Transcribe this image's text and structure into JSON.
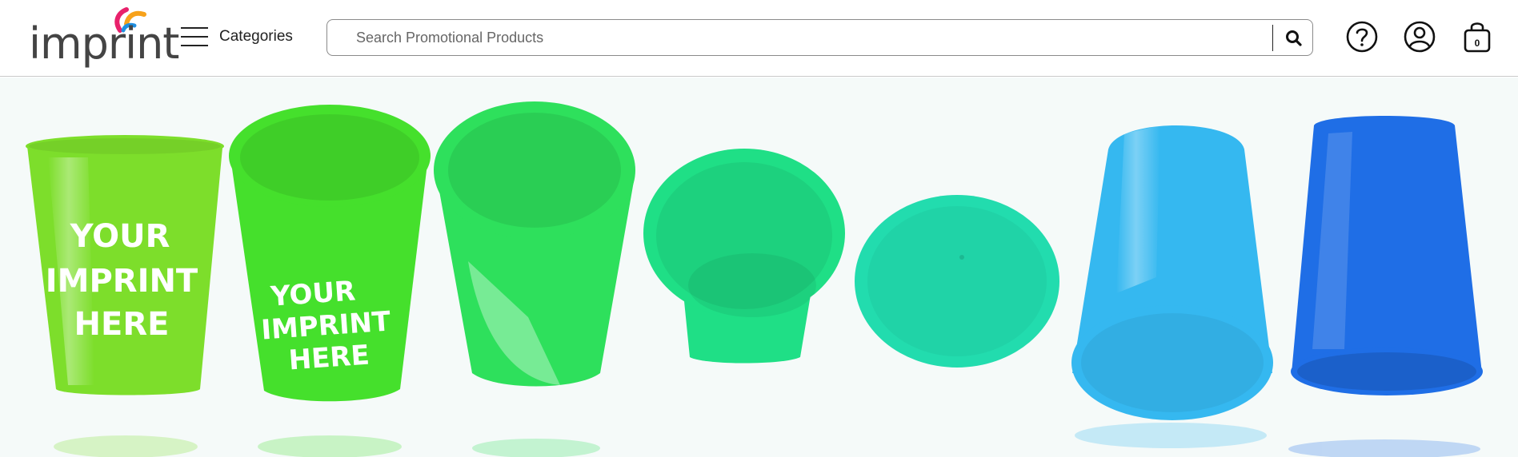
{
  "brand": {
    "logo_text": "imprint",
    "swoosh_colors": [
      "#e8216b",
      "#f7a21b",
      "#1f8fe0"
    ]
  },
  "header": {
    "categories_label": "Categories",
    "search_placeholder": "Search Promotional Products",
    "cart_count": "0",
    "icons": [
      "menu-icon",
      "search-icon",
      "help-icon",
      "account-icon",
      "cart-icon"
    ]
  },
  "hero": {
    "imprint_lines": [
      "YOUR",
      "IMPRINT",
      "HERE"
    ],
    "cup_colors": [
      "#7dde2b",
      "#45e02c",
      "#2ee05c",
      "#1fdf86",
      "#22dcae",
      "#35b8f0",
      "#1f6ee6"
    ]
  }
}
